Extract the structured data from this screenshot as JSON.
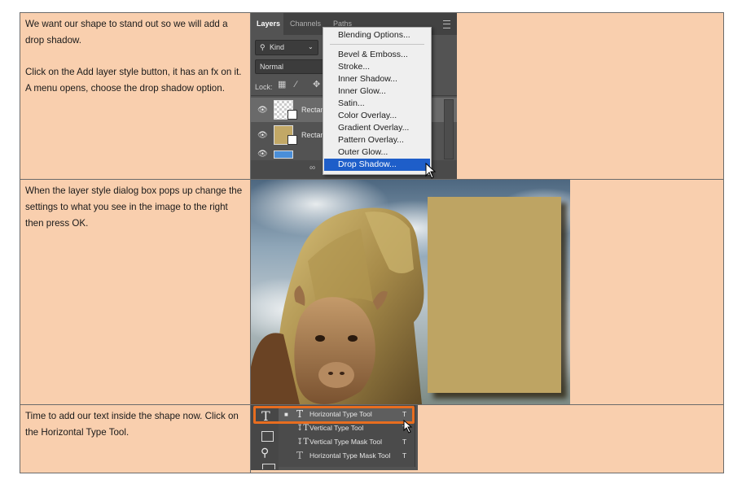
{
  "rows": [
    {
      "paragraphs": [
        "We want our shape to stand out so we will add a drop shadow.",
        "Click on the Add layer style button, it has an fx on it. A menu opens, choose the drop shadow option."
      ]
    },
    {
      "paragraphs": [
        "When the layer style dialog box pops up change the settings to what you see in the image to the right then press OK."
      ]
    },
    {
      "paragraphs": [
        "Time to add our text inside the shape now. Click on the Horizontal Type Tool."
      ]
    }
  ],
  "layers_panel": {
    "tabs": [
      "Layers",
      "Channels",
      "Paths"
    ],
    "kind_label": "Kind",
    "blend_mode": "Normal",
    "lock_label": "Lock:",
    "layers": [
      {
        "name": "Rectan"
      },
      {
        "name": "Rectan"
      }
    ]
  },
  "style_menu": {
    "items": [
      "Blending Options...",
      "Bevel & Emboss...",
      "Stroke...",
      "Inner Shadow...",
      "Inner Glow...",
      "Satin...",
      "Color Overlay...",
      "Gradient Overlay...",
      "Pattern Overlay...",
      "Outer Glow...",
      "Drop Shadow..."
    ],
    "highlighted": "Drop Shadow..."
  },
  "type_tools": {
    "items": [
      {
        "label": "Horizontal Type Tool",
        "key": "T"
      },
      {
        "label": "Vertical Type Tool",
        "key": "T"
      },
      {
        "label": "Vertical Type Mask Tool",
        "key": "T"
      },
      {
        "label": "Horizontal Type Mask Tool",
        "key": "T"
      }
    ]
  },
  "colors": {
    "cell_background": "#f9cfae",
    "shape_fill": "#bea463",
    "highlight_blue": "#1e5ec9",
    "callout_orange": "#e86d1f"
  }
}
